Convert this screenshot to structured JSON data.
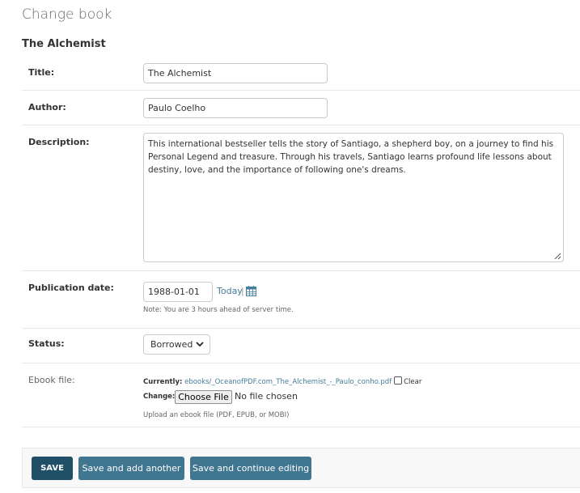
{
  "page": {
    "title": "Change book",
    "object_title": "The Alchemist"
  },
  "fields": {
    "title": {
      "label": "Title:",
      "value": "The Alchemist"
    },
    "author": {
      "label": "Author:",
      "value": "Paulo Coelho"
    },
    "description": {
      "label": "Description:",
      "value": "This international bestseller tells the story of Santiago, a shepherd boy, on a journey to find his Personal Legend and treasure. Through his travels, Santiago learns profound life lessons about destiny, love, and the importance of following one's dreams."
    },
    "publication_date": {
      "label": "Publication date:",
      "value": "1988-01-01",
      "today_link": "Today",
      "separator": "|",
      "calendar_icon": "calendar-icon",
      "note": "Note: You are 3 hours ahead of server time."
    },
    "status": {
      "label": "Status:",
      "selected": "Borrowed",
      "chevron_icon": "chevron-down-icon"
    },
    "ebook_file": {
      "label": "Ebook file:",
      "currently_label": "Currently:",
      "current_file": "ebooks/_OceanofPDF.com_The_Alchemist_-_Paulo_conho.pdf",
      "clear_label": "Clear",
      "change_label": "Change:",
      "choose_button": "Choose File",
      "no_file": "No file chosen",
      "help": "Upload an ebook file (PDF, EPUB, or MOBI)"
    }
  },
  "actions": {
    "save": "SAVE",
    "save_add_another": "Save and add another",
    "save_continue": "Save and continue editing"
  },
  "colors": {
    "link": "#447e9b",
    "button": "#417690",
    "button_default": "#205067"
  }
}
